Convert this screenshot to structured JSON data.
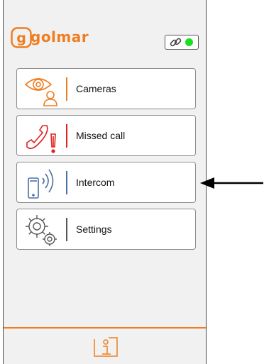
{
  "header": {
    "logo_text": "golmar",
    "link_icon": "link-icon",
    "connection_color": "#19e01e"
  },
  "menu": {
    "items": [
      {
        "label": "Cameras",
        "icon": "eye-user-icon",
        "accent": "#f07d1f"
      },
      {
        "label": "Missed call",
        "icon": "missed-call-icon",
        "accent": "#e0201f"
      },
      {
        "label": "Intercom",
        "icon": "phone-signal-icon",
        "accent": "#4a6fa5"
      },
      {
        "label": "Settings",
        "icon": "gear-icon",
        "accent": "#555555"
      }
    ]
  },
  "footer": {
    "info_icon": "info-icon"
  },
  "colors": {
    "brand": "#f07d1f",
    "background": "#f1f1f1"
  }
}
